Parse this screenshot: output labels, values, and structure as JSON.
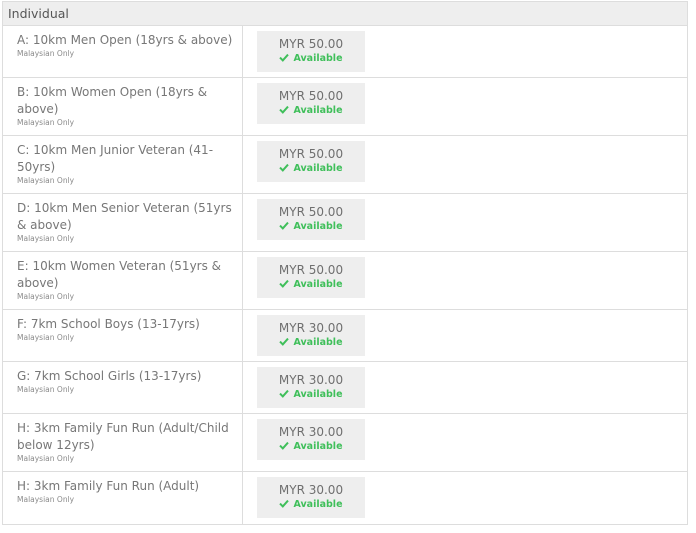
{
  "header": {
    "title": "Individual"
  },
  "rows": [
    {
      "name": "A: 10km Men Open (18yrs & above)",
      "note": "Malaysian Only",
      "price": "MYR 50.00",
      "status": "Available"
    },
    {
      "name": "B: 10km Women Open (18yrs & above)",
      "note": "Malaysian Only",
      "price": "MYR 50.00",
      "status": "Available"
    },
    {
      "name": "C: 10km Men Junior Veteran (41-50yrs)",
      "note": "Malaysian Only",
      "price": "MYR 50.00",
      "status": "Available"
    },
    {
      "name": "D: 10km Men Senior Veteran (51yrs & above)",
      "note": "Malaysian Only",
      "price": "MYR 50.00",
      "status": "Available"
    },
    {
      "name": "E: 10km Women Veteran (51yrs & above)",
      "note": "Malaysian Only",
      "price": "MYR 50.00",
      "status": "Available"
    },
    {
      "name": "F: 7km School Boys (13-17yrs)",
      "note": "Malaysian Only",
      "price": "MYR 30.00",
      "status": "Available"
    },
    {
      "name": "G: 7km School Girls (13-17yrs)",
      "note": "Malaysian Only",
      "price": "MYR 30.00",
      "status": "Available"
    },
    {
      "name": "H: 3km Family Fun Run (Adult/Child below 12yrs)",
      "note": "Malaysian Only",
      "price": "MYR 30.00",
      "status": "Available"
    },
    {
      "name": "H: 3km Family Fun Run (Adult)",
      "note": "Malaysian Only",
      "price": "MYR 30.00",
      "status": "Available"
    }
  ],
  "colors": {
    "available": "#3fbf5a",
    "header_bg": "#eeeeee",
    "price_bg": "#eeeeee",
    "border": "#dddddd"
  },
  "icons": {
    "status": "check-icon"
  }
}
